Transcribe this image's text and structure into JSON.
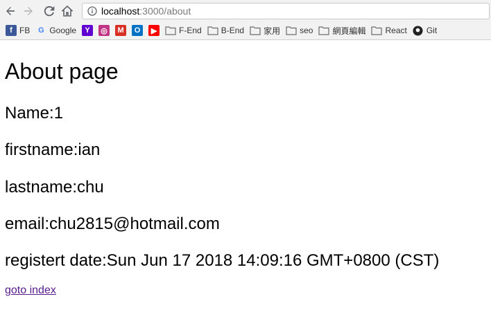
{
  "browser": {
    "url_host": "localhost",
    "url_path": ":3000/about",
    "bookmarks": [
      {
        "label": "FB",
        "icon": "facebook-icon",
        "color": "#3b5998"
      },
      {
        "label": "Google",
        "icon": "google-icon",
        "color": "#4285f4"
      },
      {
        "label": "",
        "icon": "yahoo-icon",
        "color": "#5f01d1"
      },
      {
        "label": "",
        "icon": "instagram-icon",
        "color": "#c13584"
      },
      {
        "label": "",
        "icon": "gmail-icon",
        "color": "#d93025"
      },
      {
        "label": "",
        "icon": "outlook-icon",
        "color": "#0072c6"
      },
      {
        "label": "",
        "icon": "youtube-icon",
        "color": "#ff0000"
      },
      {
        "label": "F-End",
        "icon": "folder-icon"
      },
      {
        "label": "B-End",
        "icon": "folder-icon"
      },
      {
        "label": "家用",
        "icon": "folder-icon"
      },
      {
        "label": "seo",
        "icon": "folder-icon"
      },
      {
        "label": "網頁編輯",
        "icon": "folder-icon"
      },
      {
        "label": "React",
        "icon": "folder-icon"
      },
      {
        "label": "Git",
        "icon": "github-icon"
      }
    ]
  },
  "page": {
    "heading": "About page",
    "name_line": "Name:1",
    "firstname_line": "firstname:ian",
    "lastname_line": "lastname:chu",
    "email_line": "email:chu2815@hotmail.com",
    "date_line": "registert date:Sun Jun 17 2018 14:09:16 GMT+0800 (CST)",
    "link_text": "goto index"
  }
}
